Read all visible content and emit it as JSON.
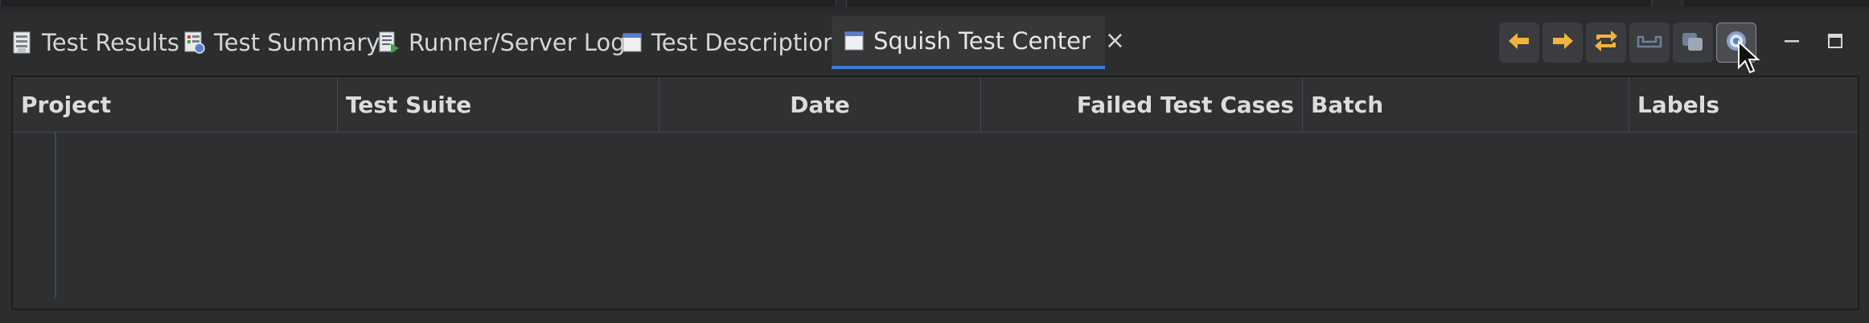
{
  "tabs": [
    {
      "label": "Test Results",
      "icon": "test-results-icon"
    },
    {
      "label": "Test Summary",
      "icon": "test-summary-icon"
    },
    {
      "label": "Runner/Server Log",
      "icon": "runner-log-icon"
    },
    {
      "label": "Test Description",
      "icon": "test-description-icon"
    },
    {
      "label": "Squish Test Center",
      "icon": "test-center-icon",
      "active": true,
      "close_glyph": "×"
    }
  ],
  "toolbar": {
    "buttons": [
      {
        "name": "previous-icon",
        "color": "#f2b33d"
      },
      {
        "name": "next-icon",
        "color": "#f2b33d"
      },
      {
        "name": "swap-icon",
        "color": "#f2b33d"
      },
      {
        "name": "inbox-icon",
        "color": "#6f7f95"
      },
      {
        "name": "stack-icon",
        "color": "#8a98a8"
      },
      {
        "name": "settings-icon",
        "color": "#c8d4e8",
        "pressed": true
      }
    ]
  },
  "window_controls": {
    "minimize": "minimize-icon",
    "maximize": "maximize-icon"
  },
  "table": {
    "columns": [
      "Project",
      "Test Suite",
      "Date",
      "Failed Test Cases",
      "Batch",
      "Labels"
    ],
    "rows": []
  },
  "colors": {
    "accent": "#3d7bd1",
    "background": "#2b2d2f"
  }
}
